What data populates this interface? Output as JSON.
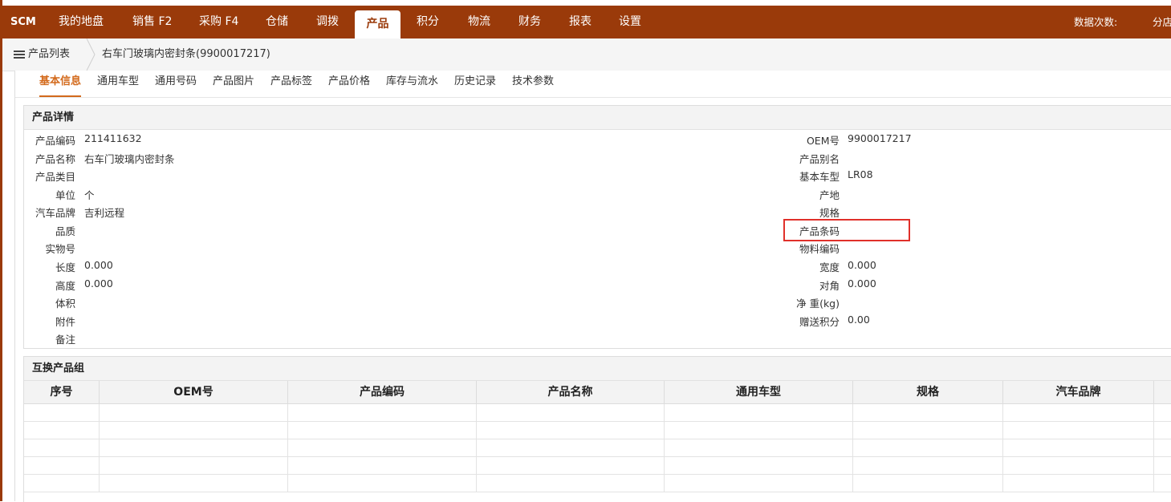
{
  "topbar": {
    "brand": "SCM",
    "nav": [
      "我的地盘",
      "销售 F2",
      "采购 F4",
      "仓储",
      "调拨",
      "产品",
      "积分",
      "物流",
      "财务",
      "报表",
      "设置"
    ],
    "active_index": 5,
    "right_label": "数据次数:",
    "right_extra": "分店",
    "bar_color": "#9a3a0a"
  },
  "breadcrumb": {
    "home_icon": "list-icon",
    "home_label": "产品列表",
    "current": "右车门玻璃内密封条(9900017217)"
  },
  "tabs": [
    "基本信息",
    "通用车型",
    "通用号码",
    "产品图片",
    "产品标签",
    "产品价格",
    "库存与流水",
    "历史记录",
    "技术参数"
  ],
  "active_tab": 0,
  "accent_color": "#d36a1c",
  "detail": {
    "title": "产品详情",
    "left": [
      {
        "label": "产品编码",
        "value": "211411632"
      },
      {
        "label": "产品名称",
        "value": "右车门玻璃内密封条"
      },
      {
        "label": "产品类目",
        "value": ""
      },
      {
        "label": "单位",
        "value": "个"
      },
      {
        "label": "汽车品牌",
        "value": "吉利远程"
      },
      {
        "label": "品质",
        "value": ""
      },
      {
        "label": "实物号",
        "value": ""
      },
      {
        "label": "长度",
        "value": "0.000"
      },
      {
        "label": "高度",
        "value": "0.000"
      },
      {
        "label": "体积",
        "value": ""
      },
      {
        "label": "附件",
        "value": ""
      },
      {
        "label": "备注",
        "value": ""
      }
    ],
    "right": [
      {
        "label": "OEM号",
        "value": "9900017217"
      },
      {
        "label": "产品别名",
        "value": ""
      },
      {
        "label": "基本车型",
        "value": "LR08"
      },
      {
        "label": "产地",
        "value": ""
      },
      {
        "label": "规格",
        "value": ""
      },
      {
        "label": "产品条码",
        "value": ""
      },
      {
        "label": "物料编码",
        "value": ""
      },
      {
        "label": "宽度",
        "value": "0.000"
      },
      {
        "label": "对角",
        "value": "0.000"
      },
      {
        "label": "净 重(kg)",
        "value": ""
      },
      {
        "label": "赠送积分",
        "value": "0.00"
      }
    ],
    "highlight_color": "#e0302a"
  },
  "interchange": {
    "title": "互换产品组",
    "columns": [
      "序号",
      "OEM号",
      "产品编码",
      "产品名称",
      "通用车型",
      "规格",
      "汽车品牌",
      ""
    ]
  }
}
